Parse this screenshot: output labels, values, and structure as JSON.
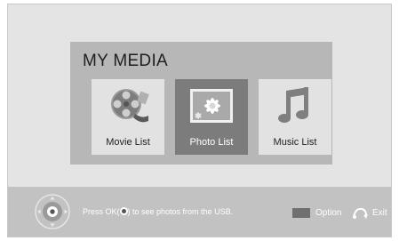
{
  "title": "MY MEDIA",
  "tiles": [
    {
      "label": "Movie List",
      "icon": "film-reel-icon"
    },
    {
      "label": "Photo List",
      "icon": "photo-icon",
      "selected": true
    },
    {
      "label": "Music List",
      "icon": "music-note-icon"
    }
  ],
  "footer": {
    "hint_before": "Press OK(",
    "hint_after": ") to see photos from the USB.",
    "option_label": "Option",
    "exit_label": "Exit"
  },
  "colors": {
    "background": "#e4e4e4",
    "panel": "#b7b7b7",
    "tile": "#e2e2e2",
    "tile_selected": "#7c7c7c",
    "footer": "#c2c2c2",
    "option_button": "#6f6f6f"
  }
}
